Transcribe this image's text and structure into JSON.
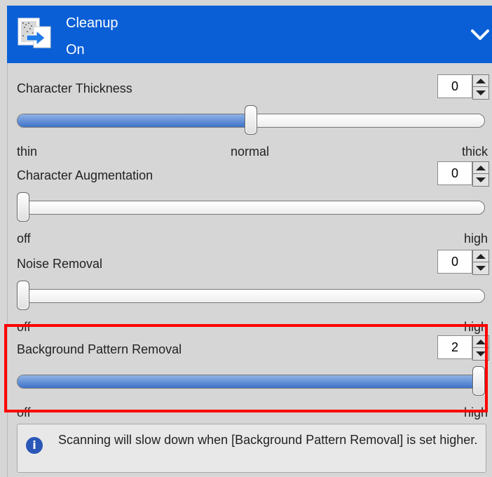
{
  "header": {
    "title": "Cleanup",
    "status": "On",
    "icons": {
      "logo": "cleanup-document-icon",
      "toggle": "chevron-down-icon"
    }
  },
  "settings": [
    {
      "label": "Character Thickness",
      "value": "0",
      "slider_fraction": 0.5,
      "ends": [
        "thin",
        "normal",
        "thick"
      ]
    },
    {
      "label": "Character Augmentation",
      "value": "0",
      "slider_fraction": 0.0,
      "ends": [
        "off",
        "high"
      ]
    },
    {
      "label": "Noise Removal",
      "value": "0",
      "slider_fraction": 0.0,
      "ends": [
        "off",
        "high"
      ]
    },
    {
      "label": "Background Pattern Removal",
      "value": "2",
      "slider_fraction": 1.0,
      "ends": [
        "off",
        "high"
      ]
    }
  ],
  "note": {
    "text": "Scanning will slow down when [Background Pattern Removal] is set higher.",
    "icon": "info-icon"
  },
  "colors": {
    "header_bg": "#0a5fd6",
    "highlight_border": "#ff0000"
  }
}
